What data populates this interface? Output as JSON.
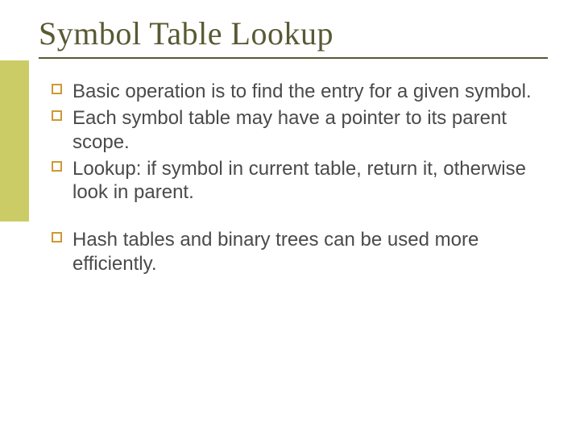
{
  "slide": {
    "title": "Symbol Table Lookup",
    "bullets": [
      {
        "text": "Basic operation is to find the entry for a given symbol."
      },
      {
        "text": "Each symbol table may have a pointer to its parent scope."
      },
      {
        "text": "Lookup: if symbol in current table, return it, otherwise look in parent."
      },
      {
        "text": "Hash tables and binary trees can be used more efficiently.",
        "gap_before": true
      }
    ]
  }
}
